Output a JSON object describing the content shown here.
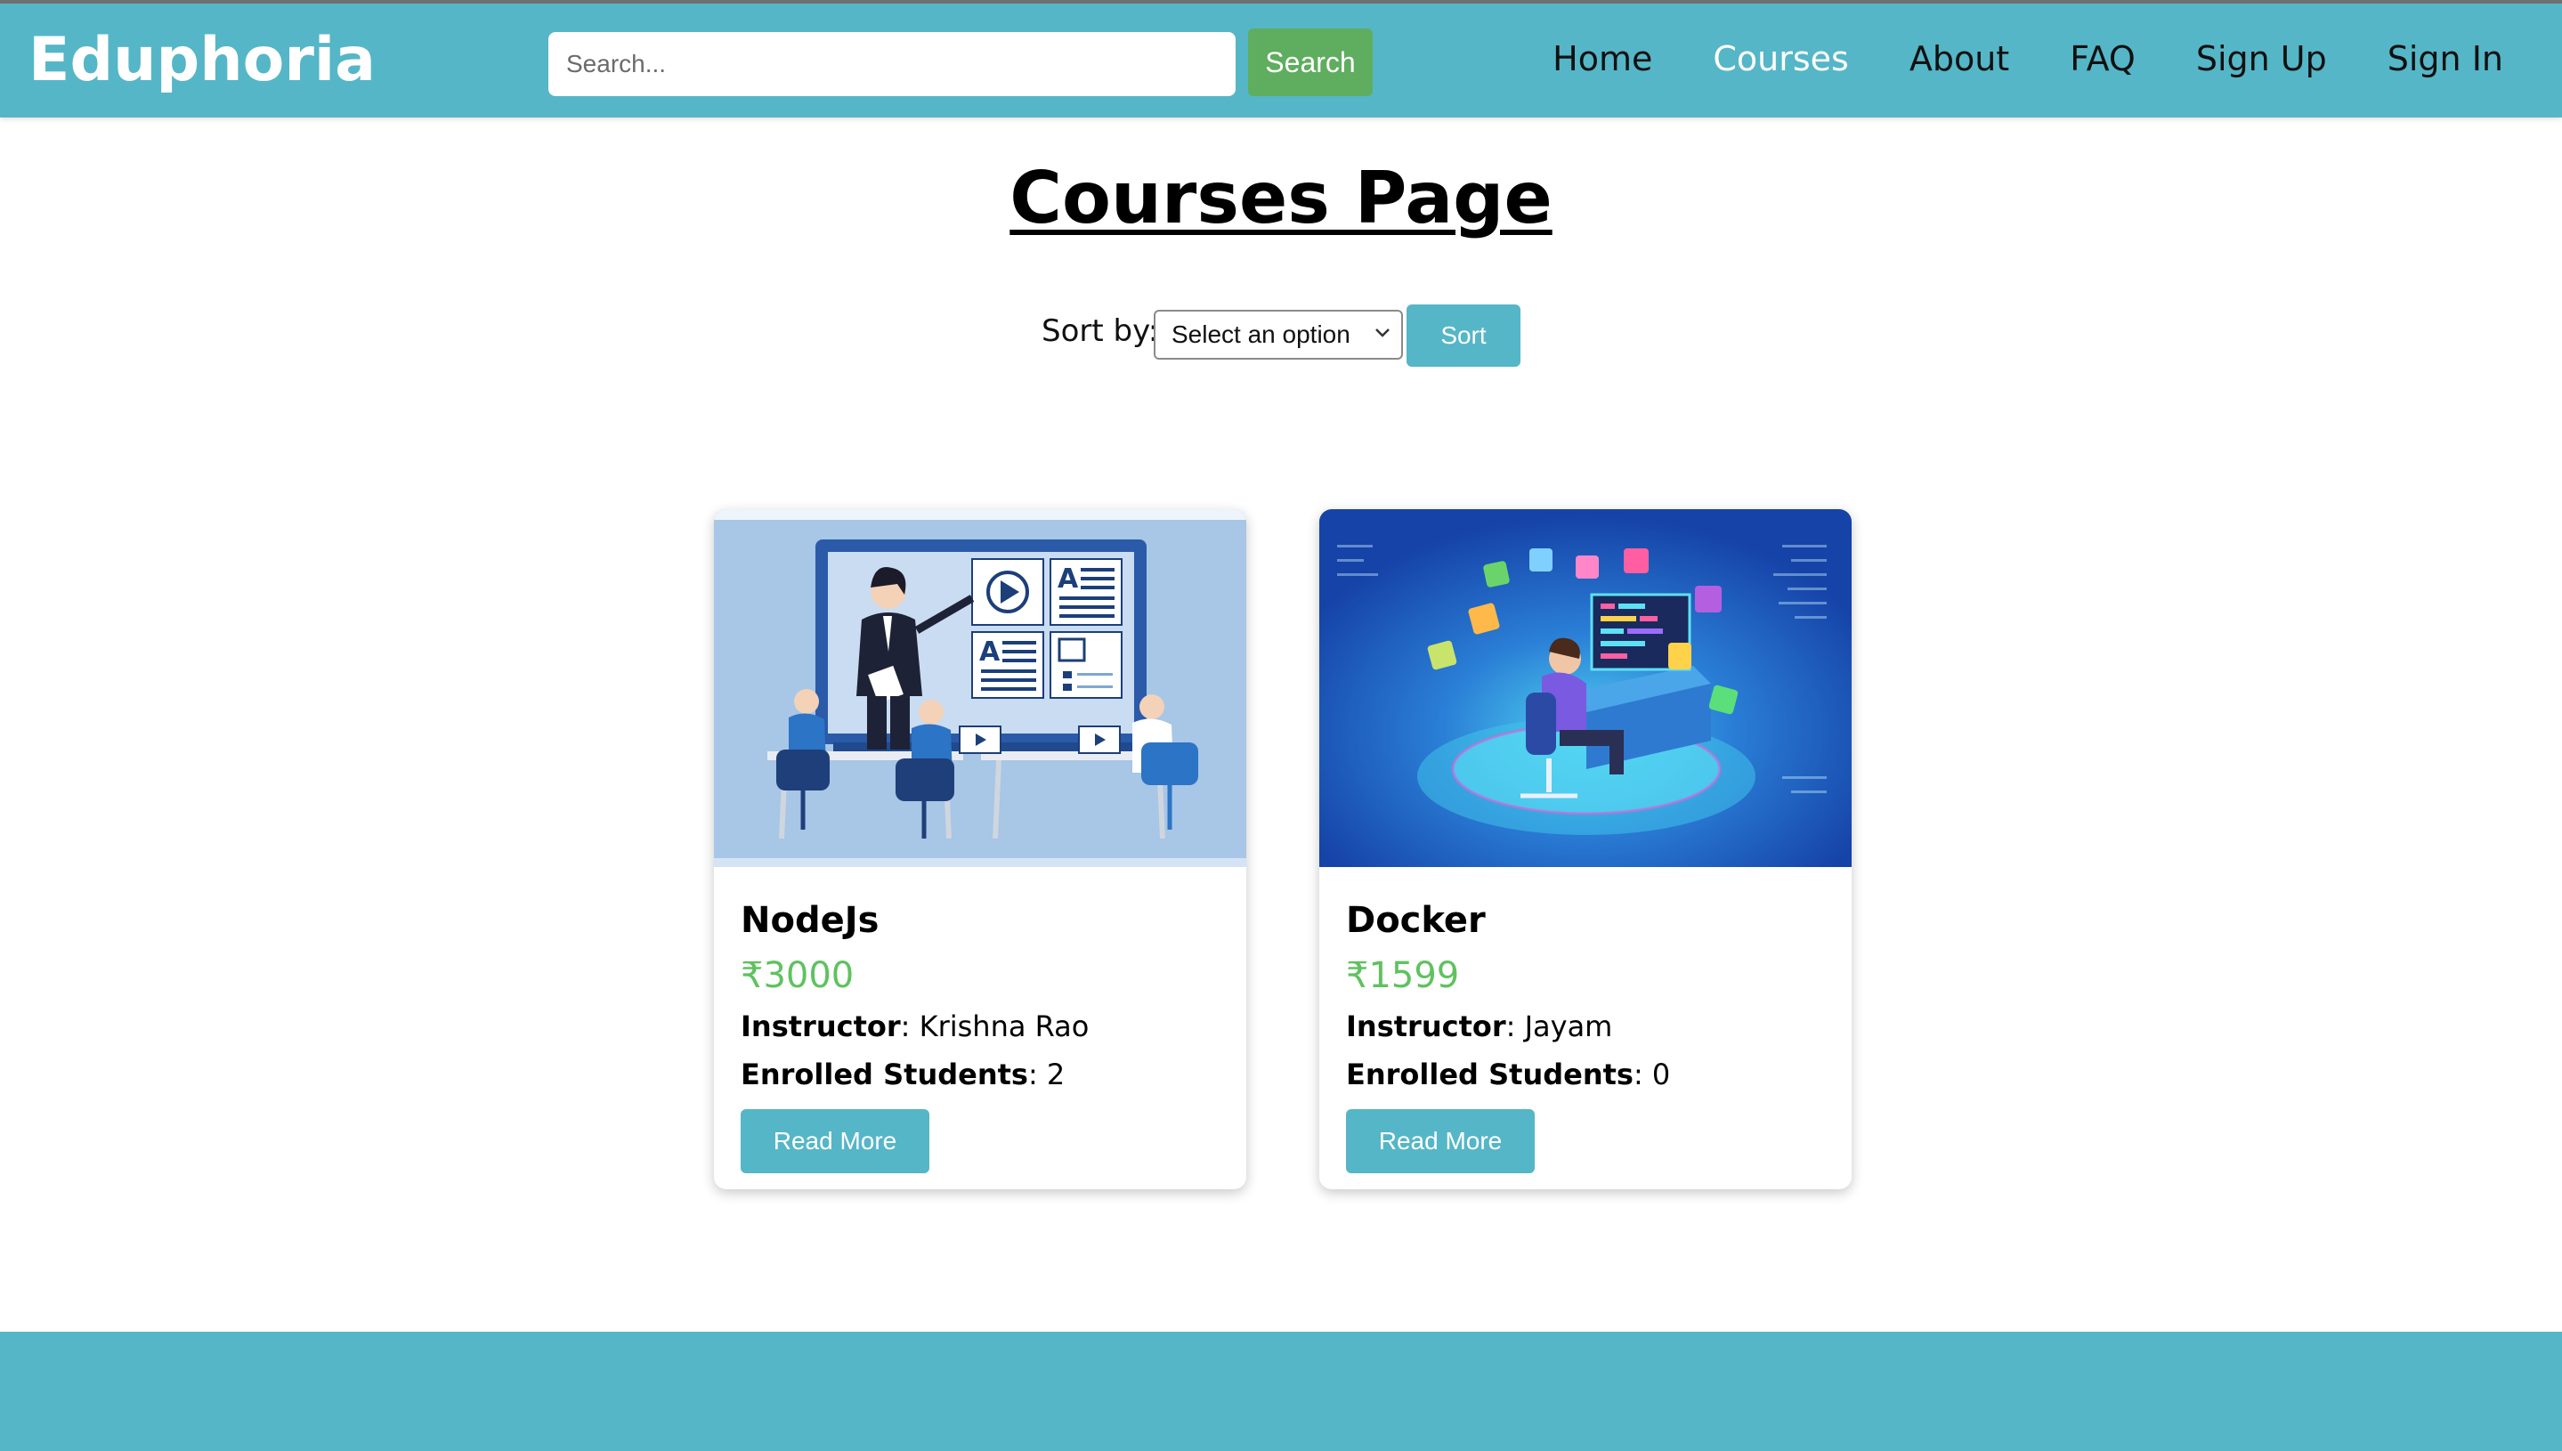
{
  "header": {
    "brand": "Eduphoria",
    "search": {
      "placeholder": "Search...",
      "value": "",
      "button_label": "Search"
    },
    "nav": [
      {
        "label": "Home",
        "active": false
      },
      {
        "label": "Courses",
        "active": true
      },
      {
        "label": "About",
        "active": false
      },
      {
        "label": "FAQ",
        "active": false
      },
      {
        "label": "Sign Up",
        "active": false
      },
      {
        "label": "Sign In",
        "active": false
      }
    ]
  },
  "main": {
    "title": "Courses Page",
    "sort": {
      "label": "Sort by:",
      "selected": "Select an option",
      "button_label": "Sort"
    },
    "courses": [
      {
        "title": "NodeJs",
        "price": "₹3000",
        "instructor_label": "Instructor",
        "instructor": ": Krishna Rao",
        "enrolled_label": "Enrolled Students",
        "enrolled": ": 2",
        "button_label": "Read More",
        "image": "classroom-illustration"
      },
      {
        "title": "Docker",
        "price": "₹1599",
        "instructor_label": "Instructor",
        "instructor": ": Jayam",
        "enrolled_label": "Enrolled Students",
        "enrolled": ": 0",
        "button_label": "Read More",
        "image": "developer-isometric-illustration"
      }
    ]
  },
  "colors": {
    "accent": "#55b6c7",
    "search_button": "#5fad5f",
    "price": "#5fc25f",
    "nav_active": "#ffffff"
  }
}
